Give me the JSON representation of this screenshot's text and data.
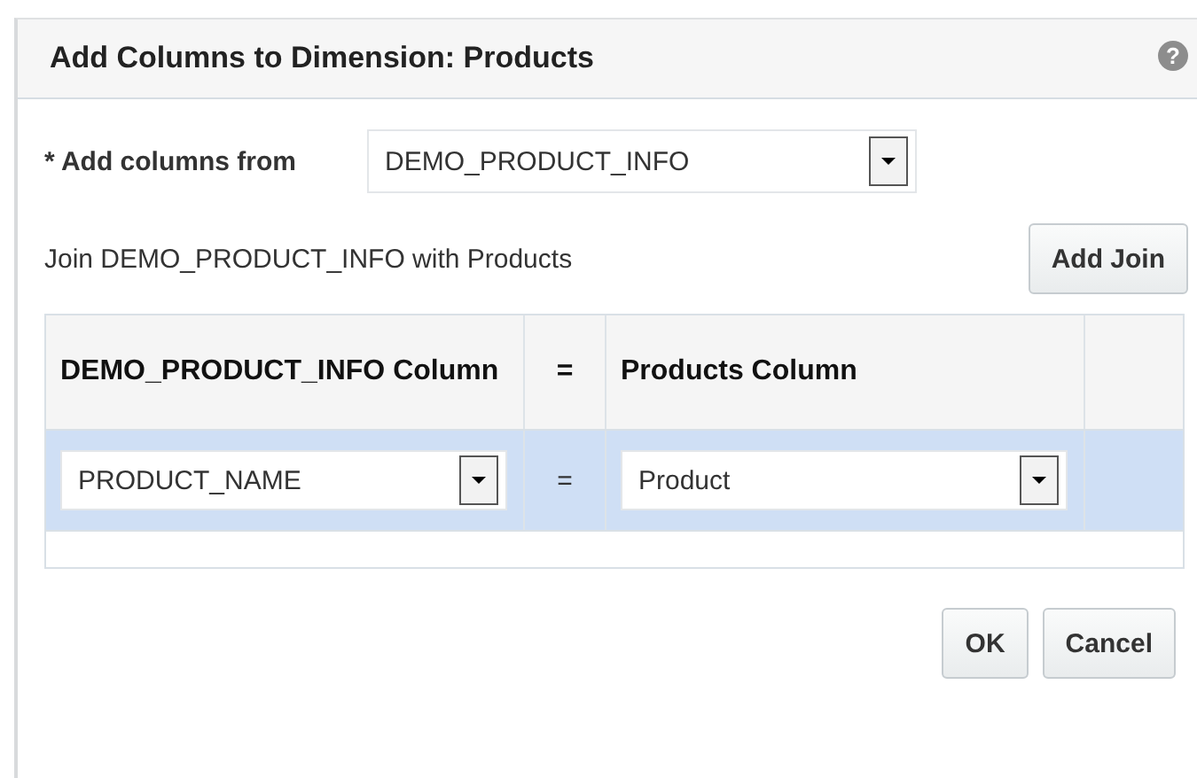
{
  "dialog": {
    "title": "Add Columns to Dimension: Products",
    "help": "?"
  },
  "source": {
    "label": "* Add columns from",
    "value": "DEMO_PRODUCT_INFO"
  },
  "join": {
    "text": "Join DEMO_PRODUCT_INFO with Products",
    "add_button": "Add Join"
  },
  "table": {
    "columns": [
      "DEMO_PRODUCT_INFO Column",
      "=",
      "Products Column"
    ],
    "rows": [
      {
        "left": "PRODUCT_NAME",
        "op": "=",
        "right": "Product",
        "selected": true
      }
    ]
  },
  "buttons": [
    "OK",
    "Cancel"
  ]
}
